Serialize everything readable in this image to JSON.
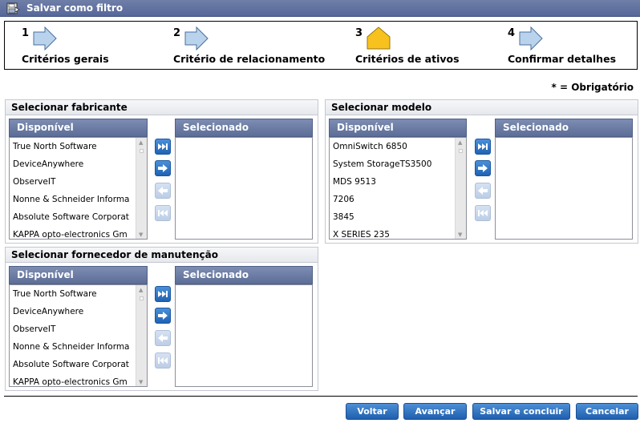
{
  "window": {
    "title": "Salvar como filtro",
    "icon": "save-filter-icon"
  },
  "wizard": {
    "steps": [
      {
        "number": "1",
        "label": "Critérios gerais",
        "state": "completed"
      },
      {
        "number": "2",
        "label": "Critério de relacionamento",
        "state": "completed"
      },
      {
        "number": "3",
        "label": "Critérios de ativos",
        "state": "current"
      },
      {
        "number": "4",
        "label": "Confirmar detalhes",
        "state": "pending"
      }
    ]
  },
  "required_note": "* = Obrigatório",
  "manufacturer": {
    "title": "Selecionar fabricante",
    "available_header": "Disponível",
    "selected_header": "Selecionado",
    "available": [
      "True North Software",
      "DeviceAnywhere",
      "ObserveIT",
      "Nonne & Schneider Informa",
      "Absolute Software Corporat",
      "KAPPA opto-electronics Gm"
    ],
    "selected": []
  },
  "model": {
    "title": "Selecionar modelo",
    "available_header": "Disponível",
    "selected_header": "Selecionado",
    "available": [
      "OmniSwitch 6850",
      "System StorageTS3500",
      "MDS 9513",
      "7206",
      "3845",
      "X SERIES 235"
    ],
    "selected": []
  },
  "supplier": {
    "title": "Selecionar fornecedor de manutenção",
    "available_header": "Disponível",
    "selected_header": "Selecionado",
    "available": [
      "True North Software",
      "DeviceAnywhere",
      "ObserveIT",
      "Nonne & Schneider Informa",
      "Absolute Software Corporat",
      "KAPPA opto-electronics Gm"
    ],
    "selected": []
  },
  "buttons": {
    "back": "Voltar",
    "next": "Avançar",
    "save_finish": "Salvar e concluir",
    "cancel": "Cancelar"
  },
  "colors": {
    "titlebar": "#5f70a0",
    "step_done": "#b9d3ec",
    "step_current": "#f7c21e",
    "list_header": "#6a7aa4",
    "button": "#2c6fc0"
  }
}
